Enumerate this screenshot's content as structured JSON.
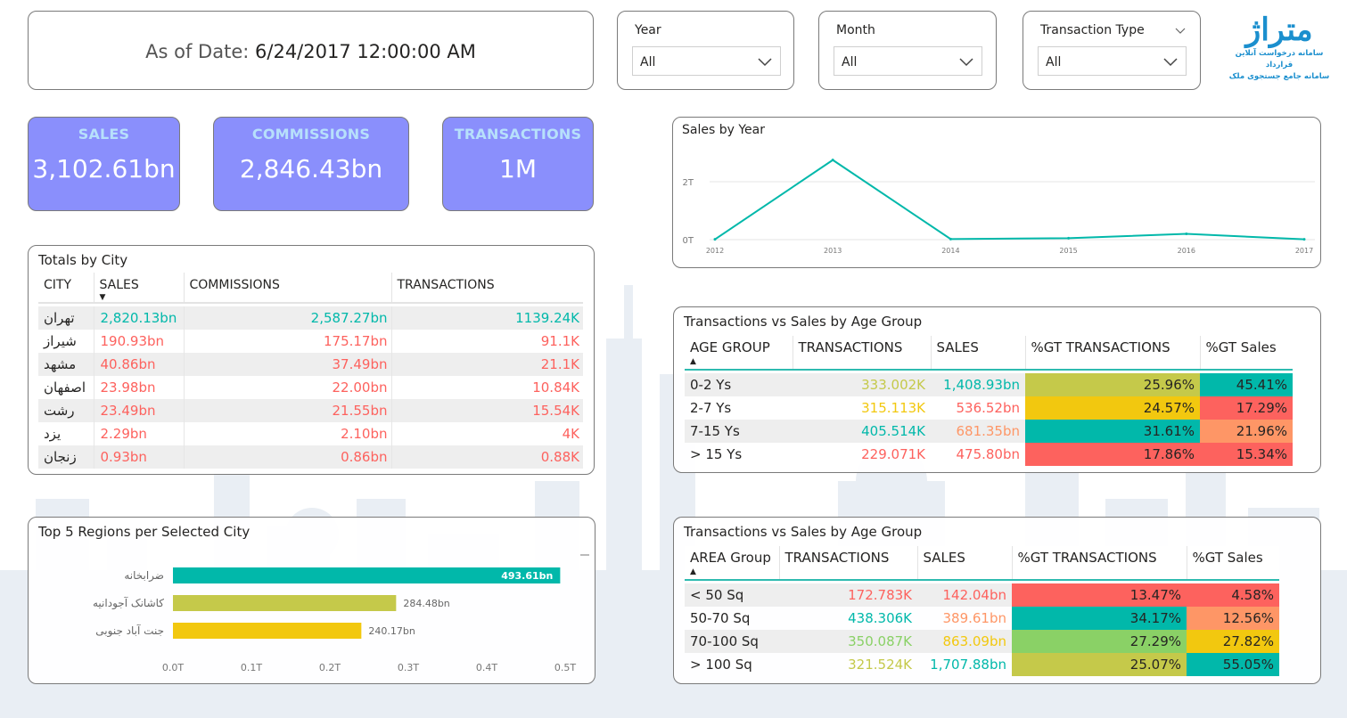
{
  "header": {
    "date_label": "As of Date:",
    "date_value": "6/24/2017 12:00:00 AM"
  },
  "slicers": {
    "year": {
      "label": "Year",
      "value": "All"
    },
    "month": {
      "label": "Month",
      "value": "All"
    },
    "transaction_type": {
      "label": "Transaction Type",
      "value": "All"
    }
  },
  "logo": {
    "name": "متراژ",
    "line1": "سامانه درخواست آنلاین قرارداد",
    "line2": "سامانه جامع جستجوی ملک"
  },
  "kpis": {
    "sales": {
      "label": "SALES",
      "value": "3,102.61bn"
    },
    "commissions": {
      "label": "COMMISSIONS",
      "value": "2,846.43bn"
    },
    "transactions": {
      "label": "TRANSACTIONS",
      "value": "1M"
    }
  },
  "colors": {
    "teal": "#01b8aa",
    "red": "#fd625e",
    "yellow": "#f2c80f",
    "olive": "#c5c94a",
    "green": "#8ad166",
    "orange": "#fe9666",
    "kpi_bg": "#8a8ffc"
  },
  "city_table": {
    "title": "Totals by City",
    "columns": [
      "CITY",
      "SALES",
      "COMMISSIONS",
      "TRANSACTIONS"
    ],
    "rows": [
      {
        "city": "تهران",
        "sales": "2,820.13bn",
        "commissions": "2,587.27bn",
        "transactions": "1139.24K",
        "color": "#01b8aa"
      },
      {
        "city": "شیراز",
        "sales": "190.93bn",
        "commissions": "175.17bn",
        "transactions": "91.1K",
        "color": "#fd625e"
      },
      {
        "city": "مشهد",
        "sales": "40.86bn",
        "commissions": "37.49bn",
        "transactions": "21.1K",
        "color": "#fd625e"
      },
      {
        "city": "اصفهان",
        "sales": "23.98bn",
        "commissions": "22.00bn",
        "transactions": "10.84K",
        "color": "#fd625e"
      },
      {
        "city": "رشت",
        "sales": "23.49bn",
        "commissions": "21.55bn",
        "transactions": "15.54K",
        "color": "#fd625e"
      },
      {
        "city": "یزد",
        "sales": "2.29bn",
        "commissions": "2.10bn",
        "transactions": "4K",
        "color": "#fd625e"
      },
      {
        "city": "زنجان",
        "sales": "0.93bn",
        "commissions": "0.86bn",
        "transactions": "0.88K",
        "color": "#fd625e"
      }
    ]
  },
  "regions_chart": {
    "title": "Top 5 Regions per Selected City",
    "chart_data": {
      "type": "bar",
      "orientation": "horizontal",
      "categories": [
        "ضرابخانه",
        "کاشانک آجودانیه",
        "جنت آباد جنوبی"
      ],
      "values": [
        493.61,
        284.48,
        240.17
      ],
      "value_labels": [
        "493.61bn",
        "284.48bn",
        "240.17bn"
      ],
      "bar_colors": [
        "#01b8aa",
        "#c5c94a",
        "#f2c80f"
      ],
      "x_ticks": [
        "0.0T",
        "0.1T",
        "0.2T",
        "0.3T",
        "0.4T",
        "0.5T"
      ],
      "xlim": [
        0,
        500
      ]
    }
  },
  "year_chart": {
    "title": "Sales by Year",
    "chart_data": {
      "type": "line",
      "x": [
        "2012",
        "2013",
        "2014",
        "2015",
        "2016",
        "2017"
      ],
      "values": [
        0.01,
        2.75,
        0.02,
        0.05,
        0.2,
        0.01
      ],
      "y_ticks": [
        "0T",
        "2T"
      ],
      "ylim": [
        0,
        3
      ],
      "color": "#01b8aa",
      "grid": true
    }
  },
  "age_table": {
    "title": "Transactions vs Sales by Age Group",
    "columns": [
      "AGE GROUP",
      "TRANSACTIONS",
      "SALES",
      "%GT TRANSACTIONS",
      "%GT Sales"
    ],
    "rows": [
      {
        "group": "0-2 Ys",
        "transactions": "333.002K",
        "sales": "1,408.93bn",
        "gt_trans": "25.96%",
        "gt_sales": "45.41%",
        "c_trans": "#c5c94a",
        "c_sales": "#01b8aa",
        "bg_gt_trans": "#c5c94a",
        "bg_gt_sales": "#01b8aa"
      },
      {
        "group": "2-7 Ys",
        "transactions": "315.113K",
        "sales": "536.52bn",
        "gt_trans": "24.57%",
        "gt_sales": "17.29%",
        "c_trans": "#f2c80f",
        "c_sales": "#fd625e",
        "bg_gt_trans": "#f2c80f",
        "bg_gt_sales": "#fd625e"
      },
      {
        "group": "7-15 Ys",
        "transactions": "405.514K",
        "sales": "681.35bn",
        "gt_trans": "31.61%",
        "gt_sales": "21.96%",
        "c_trans": "#01b8aa",
        "c_sales": "#fe9666",
        "bg_gt_trans": "#01b8aa",
        "bg_gt_sales": "#fe9666"
      },
      {
        "group": "> 15 Ys",
        "transactions": "229.071K",
        "sales": "475.80bn",
        "gt_trans": "17.86%",
        "gt_sales": "15.34%",
        "c_trans": "#fd625e",
        "c_sales": "#fd625e",
        "bg_gt_trans": "#fd625e",
        "bg_gt_sales": "#fd625e"
      }
    ]
  },
  "area_table": {
    "title": "Transactions vs Sales by Age Group",
    "columns": [
      "AREA Group",
      "TRANSACTIONS",
      "SALES",
      "%GT TRANSACTIONS",
      "%GT Sales"
    ],
    "rows": [
      {
        "group": "< 50 Sq",
        "transactions": "172.783K",
        "sales": "142.04bn",
        "gt_trans": "13.47%",
        "gt_sales": "4.58%",
        "c_trans": "#fd625e",
        "c_sales": "#fd625e",
        "bg_gt_trans": "#fd625e",
        "bg_gt_sales": "#fd625e"
      },
      {
        "group": "50-70 Sq",
        "transactions": "438.306K",
        "sales": "389.61bn",
        "gt_trans": "34.17%",
        "gt_sales": "12.56%",
        "c_trans": "#01b8aa",
        "c_sales": "#fe9666",
        "bg_gt_trans": "#01b8aa",
        "bg_gt_sales": "#fe9666"
      },
      {
        "group": "70-100 Sq",
        "transactions": "350.087K",
        "sales": "863.09bn",
        "gt_trans": "27.29%",
        "gt_sales": "27.82%",
        "c_trans": "#8ad166",
        "c_sales": "#f2c80f",
        "bg_gt_trans": "#8ad166",
        "bg_gt_sales": "#f2c80f"
      },
      {
        "group": "> 100 Sq",
        "transactions": "321.524K",
        "sales": "1,707.88bn",
        "gt_trans": "25.07%",
        "gt_sales": "55.05%",
        "c_trans": "#c5c94a",
        "c_sales": "#01b8aa",
        "bg_gt_trans": "#c5c94a",
        "bg_gt_sales": "#01b8aa"
      }
    ]
  }
}
